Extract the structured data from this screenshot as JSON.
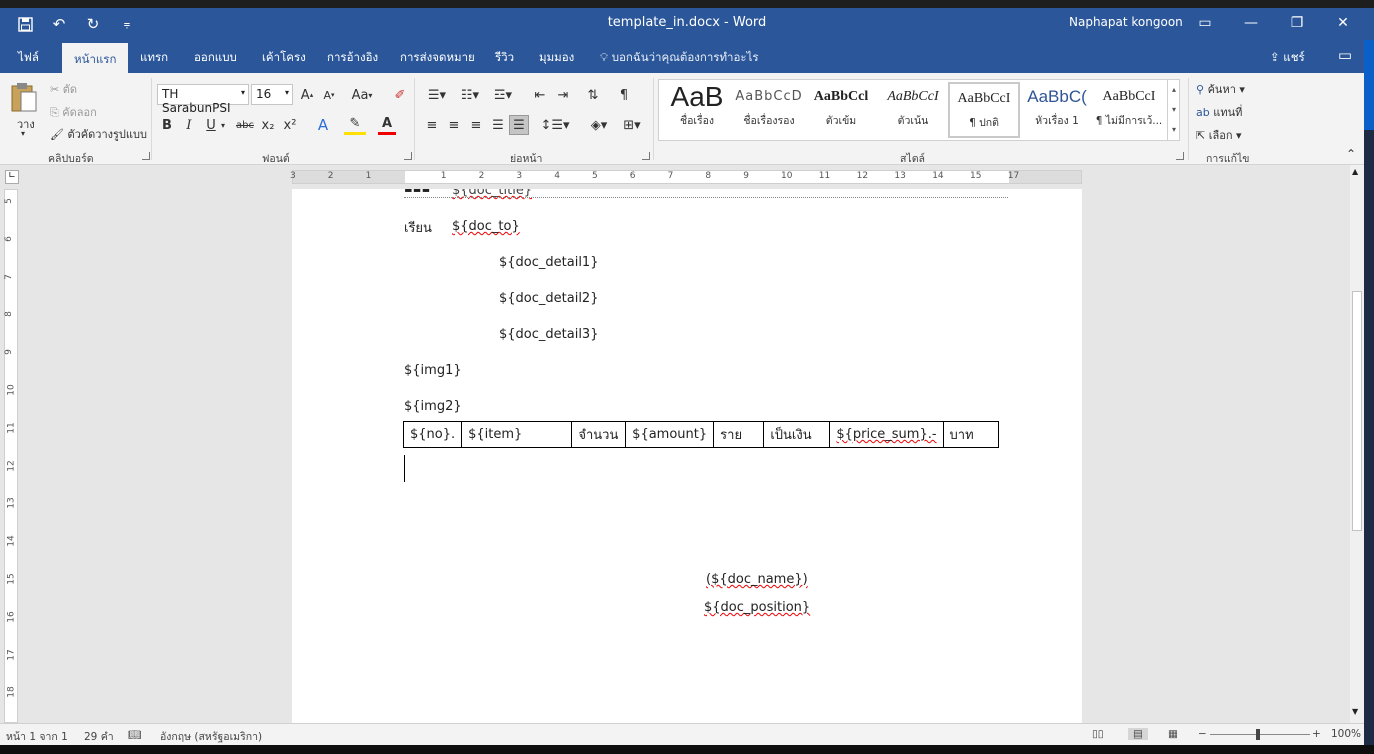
{
  "window": {
    "title": "template_in.docx - Word",
    "user": "Naphapat kongoon"
  },
  "tabs": [
    "ไฟล์",
    "หน้าแรก",
    "แทรก",
    "ออกแบบ",
    "เค้าโครง",
    "การอ้างอิง",
    "การส่งจดหมาย",
    "รีวิว",
    "มุมมอง"
  ],
  "tell_me": "บอกฉันว่าคุณต้องการทำอะไร",
  "share": "แชร์",
  "clipboard": {
    "paste": "วาง",
    "cut": "ตัด",
    "copy": "คัดลอก",
    "format_painter": "ตัวคัดวางรูปแบบ",
    "group": "คลิปบอร์ด"
  },
  "font": {
    "name": "TH SarabunPSI",
    "size": "16",
    "group": "ฟอนต์",
    "change_case": "Aa",
    "bold": "B",
    "italic": "I",
    "underline": "U",
    "strike": "abc",
    "subscript": "x₂",
    "superscript": "x²"
  },
  "paragraph": {
    "group": "ย่อหน้า",
    "pilcrow": "¶"
  },
  "styles": {
    "group": "สไตล์",
    "items": [
      {
        "preview": "AaB",
        "name": "ชื่อเรื่อง"
      },
      {
        "preview": "AaBbCcD",
        "name": "ชื่อเรื่องรอง"
      },
      {
        "preview": "AaBbCcl",
        "name": "ตัวเข้ม"
      },
      {
        "preview": "AaBbCcI",
        "name": "ตัวเน้น"
      },
      {
        "preview": "AaBbCcI",
        "name": "¶ ปกติ"
      },
      {
        "preview": "AaBbC(",
        "name": "หัวเรื่อง 1"
      },
      {
        "preview": "AaBbCcI",
        "name": "¶ ไม่มีการเว้..."
      }
    ]
  },
  "editing": {
    "group": "การแก้ไข",
    "find": "ค้นหา",
    "replace": "แทนที่",
    "select": "เลือก"
  },
  "ruler": {
    "h_ticks": [
      "3",
      "2",
      "1",
      "1",
      "2",
      "3",
      "4",
      "5",
      "6",
      "7",
      "8",
      "9",
      "10",
      "11",
      "12",
      "13",
      "14",
      "15",
      "17"
    ],
    "v_ticks": [
      "5",
      "6",
      "7",
      "8",
      "9",
      "10",
      "11",
      "12",
      "13",
      "14",
      "15",
      "16",
      "17",
      "18"
    ]
  },
  "document": {
    "title_line": "${doc_title}",
    "to_label": "เรียน",
    "to_value": "${doc_to}",
    "detail1": "${doc_detail1}",
    "detail2": "${doc_detail2}",
    "detail3": "${doc_detail3}",
    "img1": "${img1}",
    "img2": "${img2}",
    "table_row": [
      "${no}.",
      "${item}",
      "จำนวน",
      "${amount}",
      "ราย",
      "เป็นเงิน",
      "${price_sum}.-",
      "บาท"
    ],
    "sign_name": "(${doc_name})",
    "sign_position": "${doc_position}"
  },
  "status": {
    "page": "หน้า 1 จาก 1",
    "words": "29 คำ",
    "language": "อังกฤษ (สหรัฐอเมริกา)",
    "zoom": "100%"
  }
}
